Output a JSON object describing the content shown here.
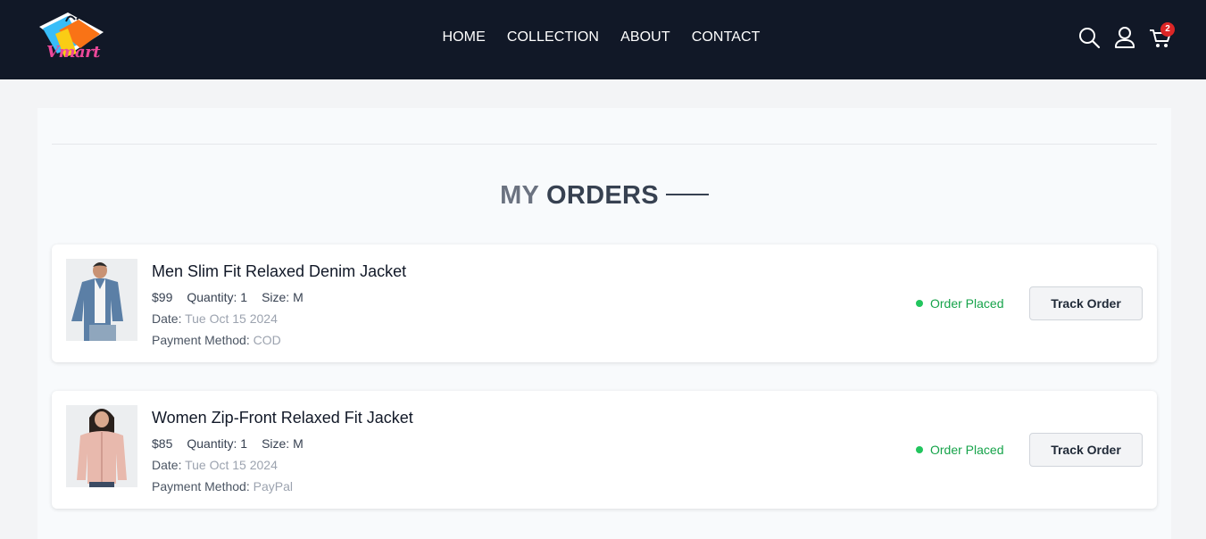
{
  "brand": {
    "name": "Vmart",
    "accent": "#ec4899",
    "nav_bg": "#111827"
  },
  "nav": {
    "links": [
      {
        "label": "HOME"
      },
      {
        "label": "COLLECTION"
      },
      {
        "label": "ABOUT"
      },
      {
        "label": "CONTACT"
      }
    ],
    "icons": [
      "search-icon",
      "user-icon",
      "cart-icon"
    ],
    "cart_count": "2"
  },
  "page": {
    "title_part1": "MY",
    "title_part2": "ORDERS"
  },
  "orders": [
    {
      "name": "Men Slim Fit Relaxed Denim Jacket",
      "price": "$99",
      "quantity_label": "Quantity: 1",
      "size_label": "Size: M",
      "date_label": "Date:",
      "date": "Tue Oct 15 2024",
      "payment_label": "Payment Method:",
      "payment": "COD",
      "status": "Order Placed",
      "action": "Track Order"
    },
    {
      "name": "Women Zip-Front Relaxed Fit Jacket",
      "price": "$85",
      "quantity_label": "Quantity: 1",
      "size_label": "Size: M",
      "date_label": "Date:",
      "date": "Tue Oct 15 2024",
      "payment_label": "Payment Method:",
      "payment": "PayPal",
      "status": "Order Placed",
      "action": "Track Order"
    }
  ],
  "colors": {
    "status_green": "#16a34a",
    "badge_red": "#dc2626"
  }
}
